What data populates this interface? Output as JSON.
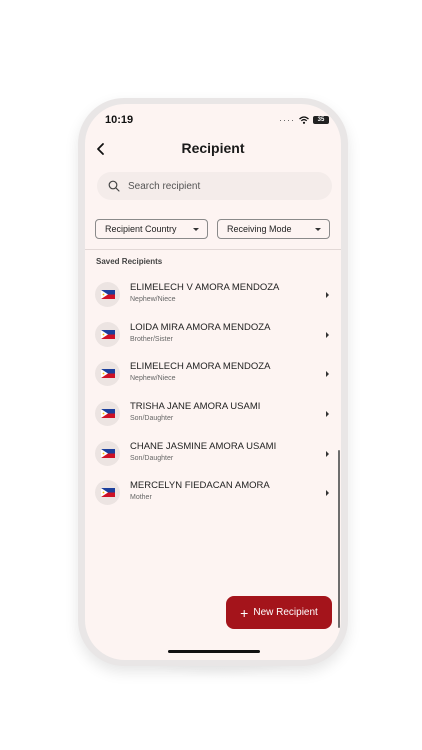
{
  "status_bar": {
    "time": "10:19",
    "battery": "35"
  },
  "header": {
    "title": "Recipient"
  },
  "search": {
    "placeholder": "Search recipient"
  },
  "filters": {
    "country_label": "Recipient Country",
    "mode_label": "Receiving Mode"
  },
  "section_title": "Saved Recipients",
  "recipients": [
    {
      "name": "ELIMELECH V AMORA MENDOZA",
      "relation": "Nephew/Niece",
      "flag": "philippines-flag-icon"
    },
    {
      "name": "LOIDA MIRA AMORA MENDOZA",
      "relation": "Brother/Sister",
      "flag": "philippines-flag-icon"
    },
    {
      "name": "ELIMELECH AMORA MENDOZA",
      "relation": "Nephew/Niece",
      "flag": "philippines-flag-icon"
    },
    {
      "name": "TRISHA JANE AMORA USAMI",
      "relation": "Son/Daughter",
      "flag": "philippines-flag-icon"
    },
    {
      "name": "CHANE JASMINE AMORA USAMI",
      "relation": "Son/Daughter",
      "flag": "philippines-flag-icon"
    },
    {
      "name": "MERCELYN FIEDACAN AMORA",
      "relation": "Mother",
      "flag": "philippines-flag-icon"
    }
  ],
  "fab": {
    "icon": "plus",
    "label": "New Recipient"
  },
  "colors": {
    "accent": "#a4141b",
    "background": "#fdf4f2"
  }
}
